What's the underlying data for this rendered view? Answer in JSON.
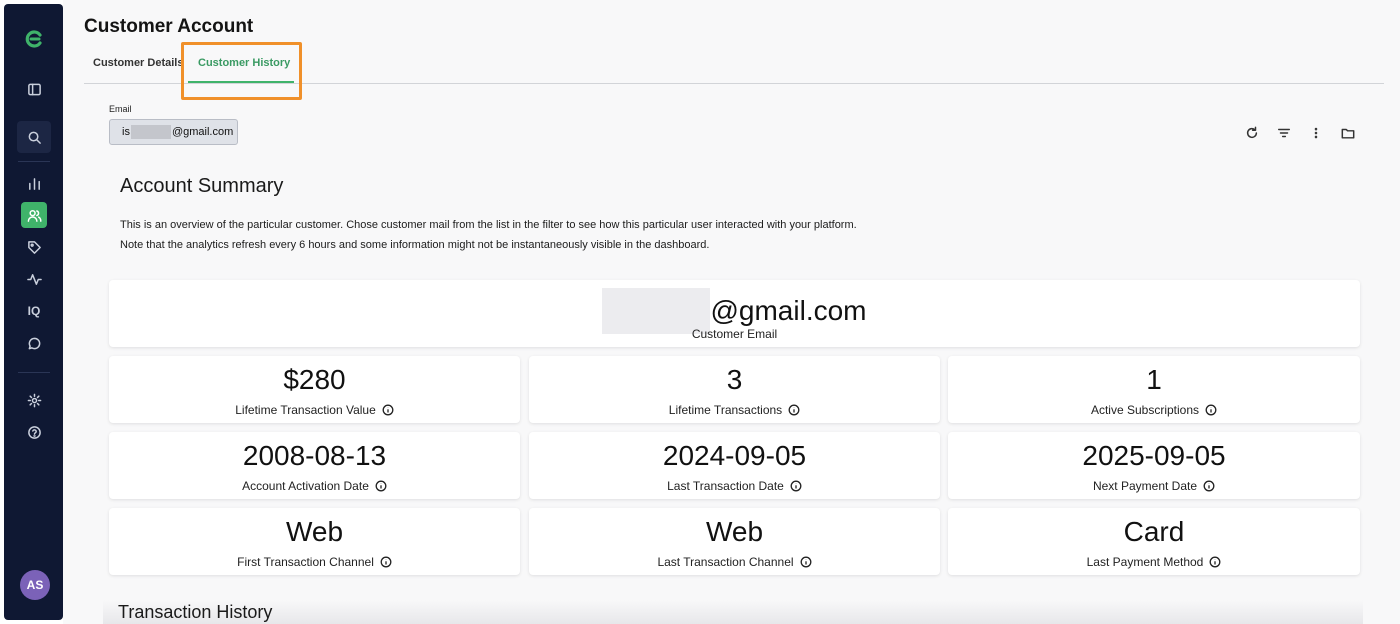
{
  "sidebar": {
    "items": [
      {
        "icon": "logo-icon"
      },
      {
        "icon": "panel-toggle-icon"
      },
      {
        "icon": "search-icon"
      },
      {
        "icon": "bar-chart-icon"
      },
      {
        "icon": "users-icon",
        "active": true
      },
      {
        "icon": "tag-icon"
      },
      {
        "icon": "activity-icon"
      },
      {
        "icon": "iq-icon",
        "label": "IQ"
      },
      {
        "icon": "chat-icon"
      },
      {
        "icon": "settings-icon"
      },
      {
        "icon": "help-icon"
      }
    ],
    "avatar_initials": "AS",
    "accent_color": "#3fb36a",
    "background_color": "#0f1833"
  },
  "header": {
    "title": "Customer Account"
  },
  "tabs": [
    {
      "label": "Customer Details",
      "active": false
    },
    {
      "label": "Customer History",
      "active": true
    }
  ],
  "filter": {
    "label": "Email",
    "value_prefix": "is",
    "value_suffix": "@gmail.com"
  },
  "toolbar": {
    "icons": [
      "refresh-icon",
      "filter-icon",
      "more-vertical-icon",
      "folder-icon"
    ]
  },
  "summary": {
    "title": "Account Summary",
    "description_line1": "This is an overview of the particular customer. Chose customer mail from the list in the filter to see how this particular user interacted with your platform.",
    "description_line2": "Note that the analytics refresh every 6 hours and some information might not be instantaneously visible in the dashboard."
  },
  "email_card": {
    "value_suffix": "@gmail.com",
    "label": "Customer Email"
  },
  "metrics": [
    {
      "value": "$280",
      "label": "Lifetime Transaction Value"
    },
    {
      "value": "3",
      "label": "Lifetime Transactions"
    },
    {
      "value": "1",
      "label": "Active Subscriptions"
    },
    {
      "value": "2008-08-13",
      "label": "Account Activation Date"
    },
    {
      "value": "2024-09-05",
      "label": "Last Transaction Date"
    },
    {
      "value": "2025-09-05",
      "label": "Next Payment Date"
    },
    {
      "value": "Web",
      "label": "First Transaction Channel"
    },
    {
      "value": "Web",
      "label": "Last Transaction Channel"
    },
    {
      "value": "Card",
      "label": "Last Payment Method"
    }
  ],
  "transaction_history": {
    "title": "Transaction History"
  },
  "highlight_color": "#f0902a"
}
